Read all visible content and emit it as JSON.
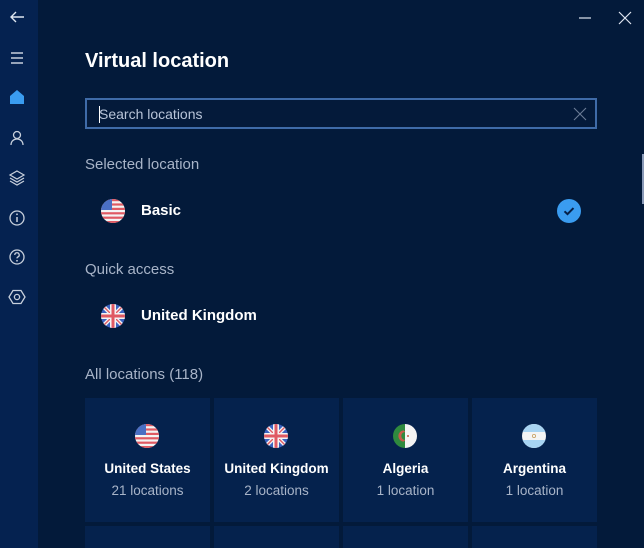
{
  "window": {
    "minimize_icon": "minimize-icon",
    "close_icon": "close-icon"
  },
  "sidebar": {
    "items": [
      {
        "name": "back",
        "icon": "arrow-left-icon"
      },
      {
        "name": "menu",
        "icon": "hamburger-icon"
      },
      {
        "name": "home",
        "icon": "home-icon",
        "active": true
      },
      {
        "name": "account",
        "icon": "user-icon"
      },
      {
        "name": "features",
        "icon": "layers-icon"
      },
      {
        "name": "info",
        "icon": "info-icon"
      },
      {
        "name": "help",
        "icon": "help-icon"
      },
      {
        "name": "settings",
        "icon": "settings-icon"
      }
    ]
  },
  "page": {
    "title": "Virtual location"
  },
  "search": {
    "value": "",
    "placeholder": "Search locations"
  },
  "selected": {
    "label": "Selected location",
    "location": {
      "name": "Basic",
      "flag": "us-flag",
      "checked": true
    }
  },
  "quick_access": {
    "label": "Quick access",
    "location": {
      "name": "United Kingdom",
      "flag": "uk-flag"
    }
  },
  "all_locations": {
    "label": "All locations (118)",
    "items": [
      {
        "name": "United States",
        "count": "21 locations",
        "flag": "us-flag"
      },
      {
        "name": "United Kingdom",
        "count": "2 locations",
        "flag": "uk-flag"
      },
      {
        "name": "Algeria",
        "count": "1 location",
        "flag": "algeria-flag"
      },
      {
        "name": "Argentina",
        "count": "1 location",
        "flag": "argentina-flag"
      }
    ]
  },
  "colors": {
    "accent": "#3a9cf0",
    "background": "#031a3a",
    "sidebar": "#052250",
    "tile": "#05224d",
    "muted_text": "#a8b4c8"
  }
}
